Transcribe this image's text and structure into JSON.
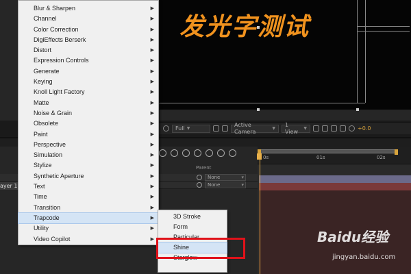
{
  "composition": {
    "title_text": "发光字测试"
  },
  "viewer_toolbar": {
    "resolution": "Full",
    "camera": "Active Camera",
    "view": "1 View",
    "exposure": "+0.0"
  },
  "timeline": {
    "layer_name": "ayer 1",
    "parent_header": "Parent",
    "rows": [
      {
        "parent": "None"
      },
      {
        "parent": "None"
      }
    ],
    "ruler_labels": [
      "0s",
      "01s",
      "02s"
    ]
  },
  "effects_menu": {
    "items": [
      {
        "label": "Blur & Sharpen"
      },
      {
        "label": "Channel"
      },
      {
        "label": "Color Correction"
      },
      {
        "label": "DigiEffects Berserk"
      },
      {
        "label": "Distort"
      },
      {
        "label": "Expression Controls"
      },
      {
        "label": "Generate"
      },
      {
        "label": "Keying"
      },
      {
        "label": "Knoll Light Factory"
      },
      {
        "label": "Matte"
      },
      {
        "label": "Noise & Grain"
      },
      {
        "label": "Obsolete"
      },
      {
        "label": "Paint"
      },
      {
        "label": "Perspective"
      },
      {
        "label": "Simulation"
      },
      {
        "label": "Stylize"
      },
      {
        "label": "Synthetic Aperture"
      },
      {
        "label": "Text"
      },
      {
        "label": "Time"
      },
      {
        "label": "Transition"
      },
      {
        "label": "Trapcode"
      },
      {
        "label": "Utility"
      },
      {
        "label": "Video Copilot"
      }
    ],
    "highlighted": "Trapcode"
  },
  "trapcode_menu": {
    "items": [
      {
        "label": "3D Stroke"
      },
      {
        "label": "Form"
      },
      {
        "label": "Particular"
      },
      {
        "label": "Shine"
      },
      {
        "label": "Starglow"
      }
    ],
    "highlighted": "Shine"
  },
  "colors": {
    "glow_text": "#f0921e",
    "highlight_box": "#e0121a",
    "menu_highlight": "#d4e4f5"
  },
  "watermark": {
    "logo": "Baidu经验",
    "site": "jingyan.baidu.com"
  }
}
